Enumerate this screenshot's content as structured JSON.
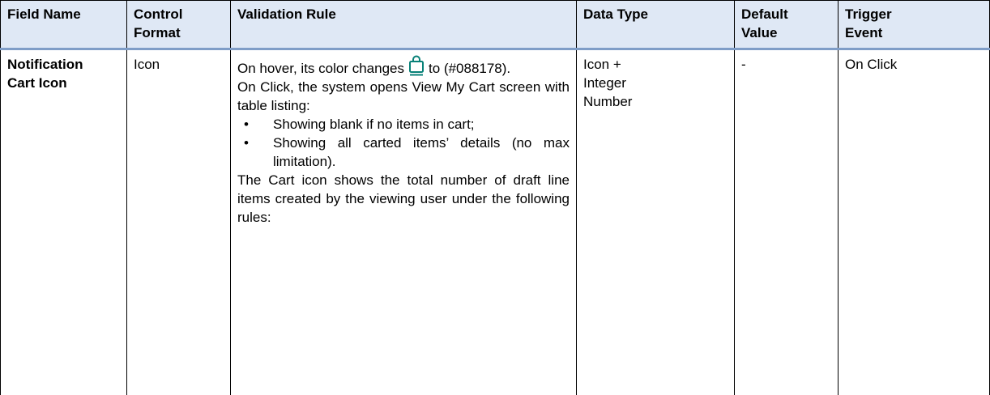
{
  "table": {
    "headers": {
      "field_name": "Field Name",
      "control_format_1": "Control",
      "control_format_2": "Format",
      "validation_rule": "Validation Rule",
      "data_type": "Data Type",
      "default_value_1": "Default",
      "default_value_2": "Value",
      "trigger_event_1": "Trigger",
      "trigger_event_2": "Event"
    },
    "rows": [
      {
        "field_name_1": "Notification",
        "field_name_2": "Cart Icon",
        "control_format": "Icon",
        "validation": {
          "hover_before": "On hover, its color changes",
          "hover_after": "to (#088178).",
          "click": "On Click,  the system opens View My Cart screen with table listing:",
          "bullets": [
            "Showing blank if no items in cart;",
            "Showing all carted items’ details (no max limitation)."
          ],
          "count_rule": "The Cart icon shows the total number of draft line items created by the viewing user under the following rules:"
        },
        "data_type_1": "Icon +",
        "data_type_2": "Integer",
        "data_type_3": "Number",
        "default_value": "-",
        "trigger_event": "On Click"
      }
    ]
  },
  "icons": {
    "cart_icon": "shopping-bag-icon",
    "cart_icon_color": "#088178",
    "bullet": "•"
  },
  "colors": {
    "header_background": "#dfe8f5",
    "header_rule": "#7f9dc7",
    "border": "#000000"
  }
}
